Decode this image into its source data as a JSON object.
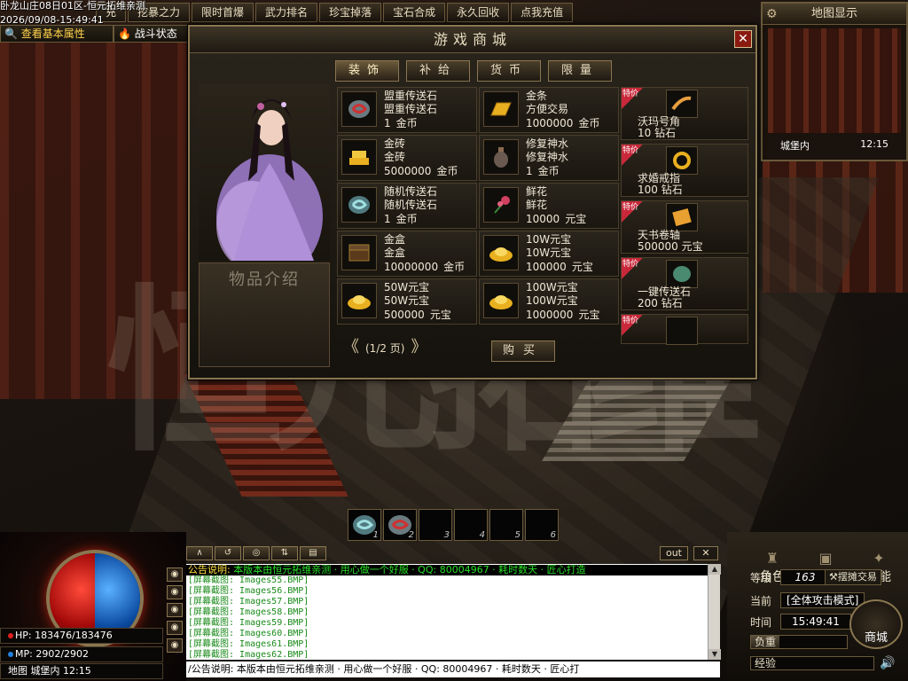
{
  "top": {
    "server_line": "卧龙山庄08日01区-恒元拓维亲测",
    "datetime": "2026/09/08-15:49:41",
    "menu": [
      "充",
      "挖暴之力",
      "限时首爆",
      "武力排名",
      "珍宝掉落",
      "宝石合成",
      "永久回收",
      "点我充值"
    ],
    "row2": {
      "view_attr": "查看基本属性",
      "fight_state": "战斗状态"
    }
  },
  "minimap": {
    "title": "地图显示",
    "map_name": "城堡内",
    "time": "12:15"
  },
  "watermark": "恒元拓维",
  "shop": {
    "title": "游戏商城",
    "close": "✕",
    "tabs": [
      "装饰",
      "补给",
      "货币",
      "限量"
    ],
    "intro_label": "物品介绍",
    "items": [
      {
        "name": "盟重传送石",
        "desc": "盟重传送石",
        "price": "1",
        "currency": "金币",
        "icon": "stone-icon",
        "color": "#d03030"
      },
      {
        "name": "金条",
        "desc": "方便交易",
        "price": "1000000",
        "currency": "金币",
        "icon": "gold-bar-icon",
        "color": "#e8b020"
      },
      {
        "name": "金砖",
        "desc": "金砖",
        "price": "5000000",
        "currency": "金币",
        "icon": "gold-brick-icon",
        "color": "#e8b020"
      },
      {
        "name": "修复神水",
        "desc": "修复神水",
        "price": "1",
        "currency": "金币",
        "icon": "potion-icon",
        "color": "#8a6a50"
      },
      {
        "name": "随机传送石",
        "desc": "随机传送石",
        "price": "1",
        "currency": "金币",
        "icon": "stone-icon",
        "color": "#40a0a0"
      },
      {
        "name": "鲜花",
        "desc": "鲜花",
        "price": "10000",
        "currency": "元宝",
        "icon": "flower-icon",
        "color": "#d04060"
      },
      {
        "name": "金盒",
        "desc": "金盒",
        "price": "10000000",
        "currency": "金币",
        "icon": "chest-icon",
        "color": "#6a4a2a"
      },
      {
        "name": "10W元宝",
        "desc": "10W元宝",
        "price": "100000",
        "currency": "元宝",
        "icon": "ingot-icon",
        "color": "#e8b020"
      },
      {
        "name": "50W元宝",
        "desc": "50W元宝",
        "price": "500000",
        "currency": "元宝",
        "icon": "ingot-icon",
        "color": "#e8b020"
      },
      {
        "name": "100W元宝",
        "desc": "100W元宝",
        "price": "1000000",
        "currency": "元宝",
        "icon": "ingot-icon",
        "color": "#e8b020"
      }
    ],
    "pager": "(1/2 页)",
    "buy_label": "购买",
    "limited_tag": "特价",
    "limited": [
      {
        "name": "沃玛号角",
        "price": "10",
        "currency": "钻石",
        "icon": "horn-icon"
      },
      {
        "name": "求婚戒指",
        "price": "100",
        "currency": "钻石",
        "icon": "ring-icon"
      },
      {
        "name": "天书卷轴",
        "price": "500000",
        "currency": "元宝",
        "icon": "scroll-icon"
      },
      {
        "name": "一键传送石",
        "price": "200",
        "currency": "钻石",
        "icon": "jade-stone-icon"
      },
      {
        "name": "",
        "price": "",
        "currency": "",
        "icon": ""
      }
    ]
  },
  "hotbar": {
    "keys": [
      "1",
      "2",
      "3",
      "4",
      "5",
      "6"
    ]
  },
  "stats": {
    "hp": "HP: 183476/183476",
    "mp": "MP: 2902/2902",
    "location": "地图 城堡内 12:15"
  },
  "chat": {
    "out_label": "out",
    "close_label": "✕",
    "notice_prefix": "公告说明: ",
    "notice_text": "本版本由恒元拓维亲测 · 用心做一个好服 · QQ: 80004967 · 耗时数天 · 匠心打造",
    "screenshot_lines": [
      "[屏幕截图: Images55.BMP]",
      "[屏幕截图: Images56.BMP]",
      "[屏幕截图: Images57.BMP]",
      "[屏幕截图: Images58.BMP]",
      "[屏幕截图: Images59.BMP]",
      "[屏幕截图: Images60.BMP]",
      "[屏幕截图: Images61.BMP]",
      "[屏幕截图: Images62.BMP]"
    ],
    "input_value": "/公告说明: 本版本由恒元拓维亲测 · 用心做一个好服 · QQ: 80004967 · 耗时数天 · 匠心打"
  },
  "panel": {
    "tabs": [
      "角色",
      "背包",
      "技能"
    ],
    "level_label": "等级",
    "level": "163",
    "stall": "摆摊交易",
    "current_label": "当前",
    "attack_mode": "[全体攻击模式]",
    "time_label": "时间",
    "time": "15:49:41",
    "weight_label": "负重",
    "weight_fill": 0.3,
    "exp_label": "经验",
    "exp_fill": 0.0,
    "shop_city": "商城"
  }
}
